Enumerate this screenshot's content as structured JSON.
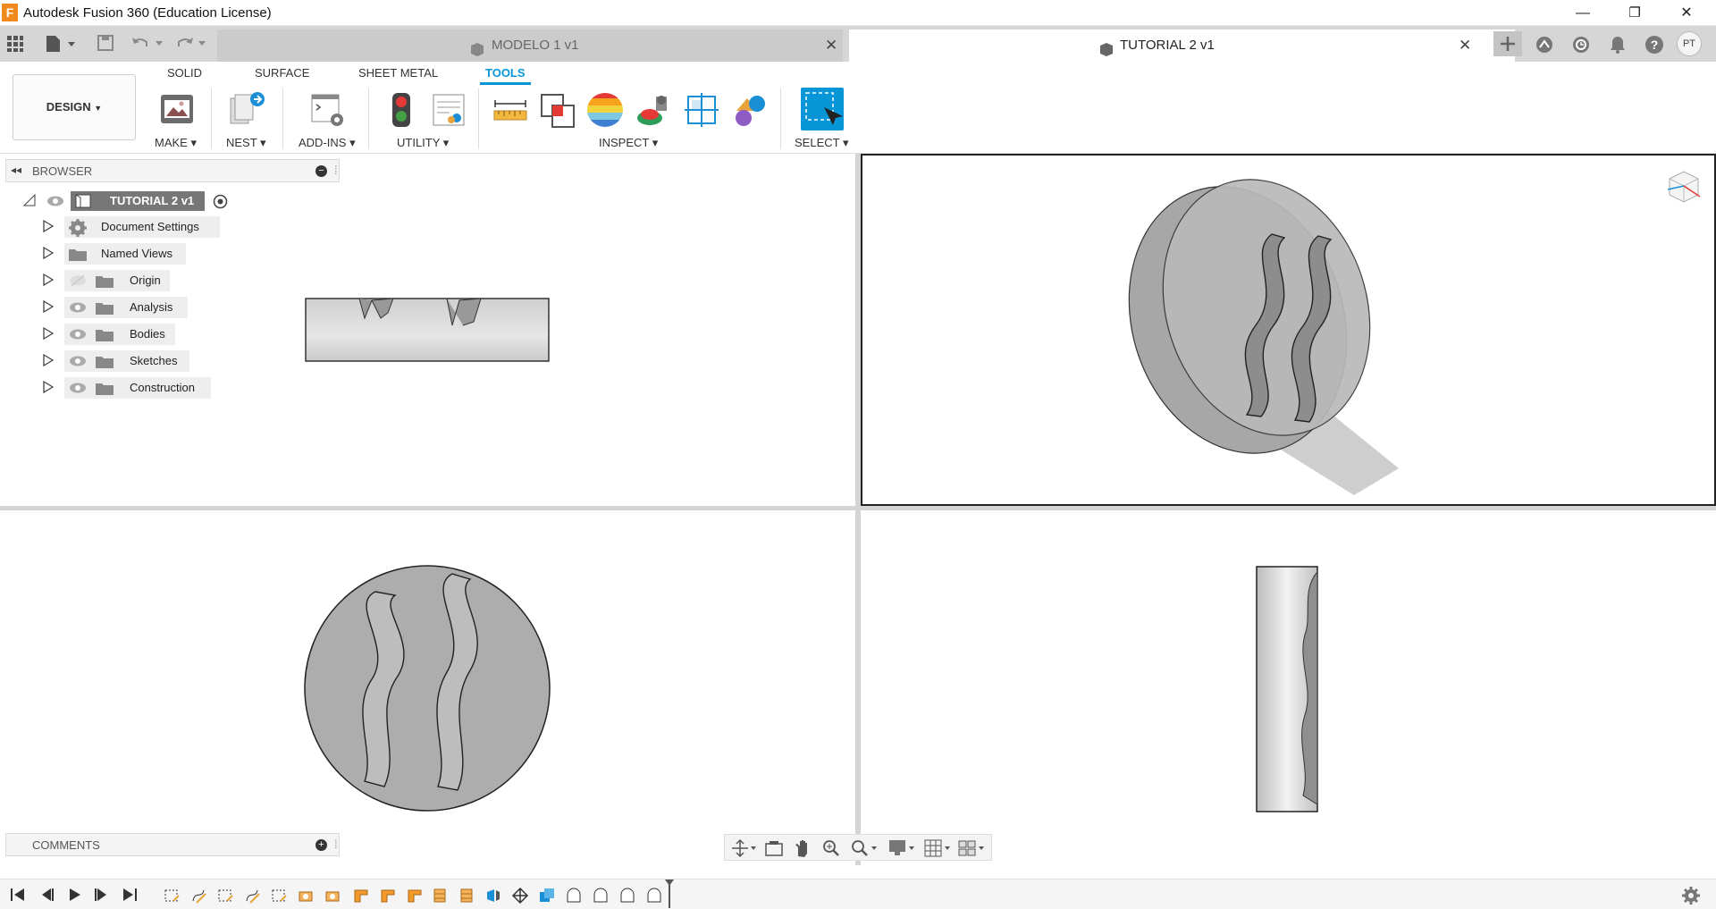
{
  "app": {
    "title": "Autodesk Fusion 360 (Education License)",
    "logo_letter": "F"
  },
  "window_controls": {
    "minimize": "—",
    "restore": "❐",
    "close": "✕"
  },
  "tabs": [
    {
      "label": "MODELO 1 v1",
      "active": false
    },
    {
      "label": "TUTORIAL 2 v1",
      "active": true
    }
  ],
  "header_icons": [
    "add-tab-icon",
    "extensions-icon",
    "job-status-icon",
    "notifications-icon",
    "help-icon"
  ],
  "user_initials": "PT",
  "ribbon": {
    "workspace": "DESIGN",
    "tabs": [
      "SOLID",
      "SURFACE",
      "SHEET METAL",
      "TOOLS"
    ],
    "active_tab": "TOOLS",
    "groups": {
      "make": "MAKE",
      "nest": "NEST",
      "addins": "ADD-INS",
      "utility": "UTILITY",
      "inspect": "INSPECT",
      "select": "SELECT"
    }
  },
  "browser": {
    "header": "BROWSER",
    "root": "TUTORIAL 2 v1",
    "items": [
      {
        "label": "Document Settings",
        "icon": "gear-icon"
      },
      {
        "label": "Named Views",
        "icon": "folder-icon"
      },
      {
        "label": "Origin",
        "icon": "folder-icon",
        "hidden": true
      },
      {
        "label": "Analysis",
        "icon": "folder-icon"
      },
      {
        "label": "Bodies",
        "icon": "folder-icon"
      },
      {
        "label": "Sketches",
        "icon": "folder-icon"
      },
      {
        "label": "Construction",
        "icon": "folder-icon"
      }
    ]
  },
  "comments": {
    "header": "COMMENTS"
  },
  "colors": {
    "accent": "#0696d7",
    "orange": "#f08a1c",
    "body_gray": "#a9a9a9"
  }
}
